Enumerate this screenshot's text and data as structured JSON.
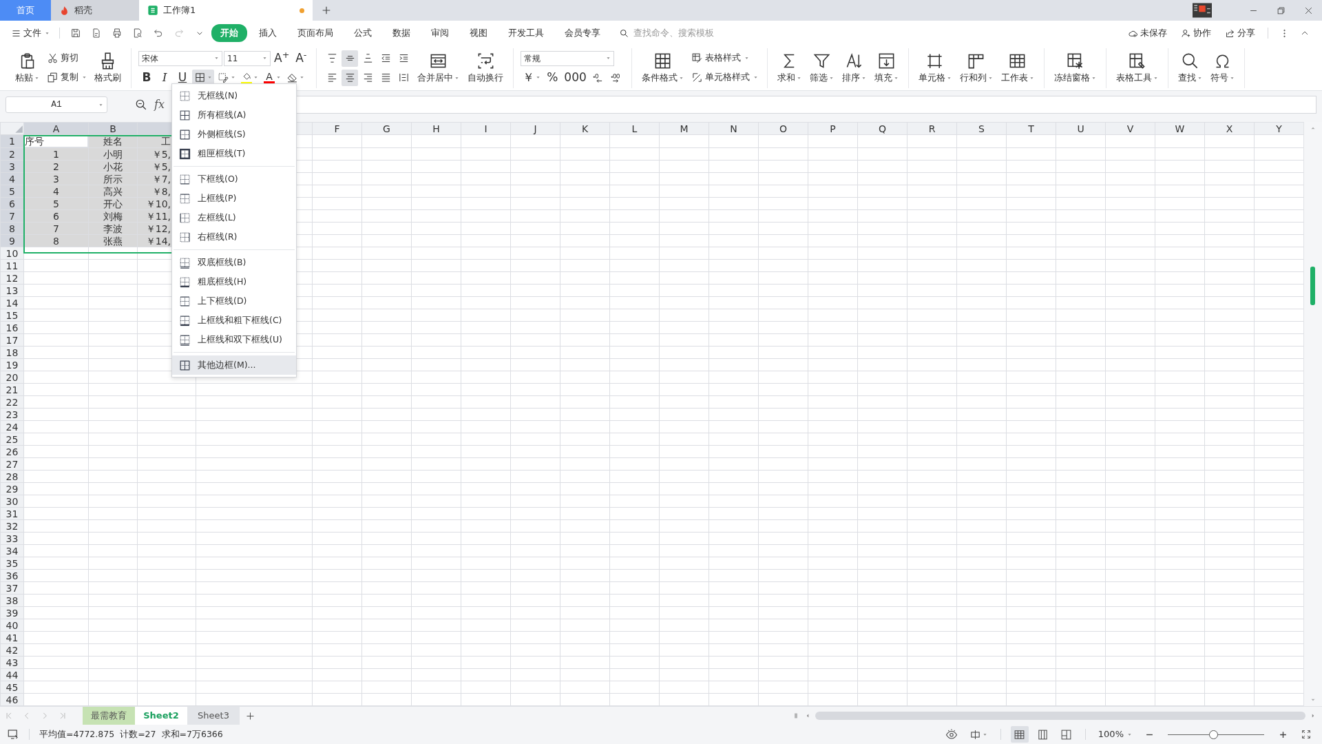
{
  "title_tabs": [
    {
      "label": "首页",
      "kind": "home",
      "selected": false
    },
    {
      "label": "稻壳",
      "kind": "docer",
      "selected": false
    },
    {
      "label": "工作簿1",
      "kind": "sheet",
      "selected": true,
      "modified": true
    }
  ],
  "menu": {
    "file": "文件",
    "tabs": [
      {
        "label": "开始",
        "selected": true
      },
      {
        "label": "插入",
        "selected": false
      },
      {
        "label": "页面布局",
        "selected": false
      },
      {
        "label": "公式",
        "selected": false
      },
      {
        "label": "数据",
        "selected": false
      },
      {
        "label": "审阅",
        "selected": false
      },
      {
        "label": "视图",
        "selected": false
      },
      {
        "label": "开发工具",
        "selected": false
      },
      {
        "label": "会员专享",
        "selected": false
      }
    ],
    "search": {
      "placeholder": "查找命令、搜索模板"
    },
    "actions": [
      "未保存",
      "协作",
      "分享"
    ]
  },
  "ribbon": [
    {
      "items": [
        {
          "kind": "large",
          "label": "粘贴",
          "caret": true
        },
        {
          "kind": "stack",
          "rows": [
            [
              {
                "kind": "small",
                "label": "剪切",
                "caret": false
              }
            ],
            [
              {
                "kind": "small",
                "label": "复制",
                "caret": true
              }
            ]
          ]
        },
        {
          "kind": "large",
          "label": "格式刷",
          "caret": false
        }
      ]
    },
    {
      "items": [
        {
          "kind": "stack",
          "rows": [
            [
              {
                "kind": "font-select",
                "value": "宋体"
              },
              {
                "kind": "size-select",
                "value": "11"
              },
              {
                "kind": "glyph",
                "label": "A$^{+}$",
                "active": false,
                "caret": false
              },
              {
                "kind": "glyph",
                "label": "A$^{-}$",
                "active": false,
                "caret": false
              }
            ],
            [
              {
                "kind": "bold-glyph",
                "label": "B",
                "active": false,
                "caret": false
              },
              {
                "kind": "italic-glyph",
                "label": "I",
                "active": false,
                "caret": false
              },
              {
                "kind": "underline-glyph",
                "label": "U",
                "active": false,
                "caret": false
              },
              {
                "kind": "icon",
                "active": true,
                "caret": true
              },
              {
                "kind": "icon",
                "active": false,
                "caret": true
              },
              {
                "kind": "icon",
                "active": false,
                "caret": true,
                "color": "#ffff00"
              },
              {
                "kind": "glyph",
                "label": "A",
                "active": false,
                "caret": true,
                "color": "#ff0000"
              },
              {
                "kind": "icon",
                "active": false,
                "caret": true
              }
            ]
          ]
        }
      ]
    },
    {
      "items": [
        {
          "kind": "stack",
          "rows": [
            [
              {
                "kind": "icon",
                "active": false,
                "caret": false
              },
              {
                "kind": "icon",
                "active": true,
                "caret": false
              },
              {
                "kind": "icon",
                "active": false,
                "caret": false
              },
              {
                "kind": "icon",
                "active": false,
                "caret": false
              },
              {
                "kind": "icon",
                "active": false,
                "caret": false
              }
            ],
            [
              {
                "kind": "icon",
                "active": false,
                "caret": false
              },
              {
                "kind": "icon",
                "active": true,
                "caret": false
              },
              {
                "kind": "icon",
                "active": false,
                "caret": false
              },
              {
                "kind": "icon",
                "active": false,
                "caret": false
              },
              {
                "kind": "icon",
                "active": false,
                "caret": false
              }
            ]
          ]
        },
        {
          "kind": "large",
          "label": "合并居中",
          "caret": true
        },
        {
          "kind": "large",
          "label": "自动换行",
          "caret": false
        }
      ]
    },
    {
      "items": [
        {
          "kind": "stack",
          "rows": [
            [
              {
                "kind": "format-select",
                "value": "常规"
              }
            ],
            [
              {
                "kind": "glyph",
                "label": "￥",
                "active": false,
                "caret": true
              },
              {
                "kind": "glyph",
                "label": "%",
                "active": false,
                "caret": false
              },
              {
                "kind": "glyph",
                "label": "000",
                "active": false,
                "caret": false
              },
              {
                "kind": "icon",
                "active": false,
                "caret": false
              },
              {
                "kind": "icon",
                "active": false,
                "caret": false
              }
            ]
          ]
        }
      ]
    },
    {
      "items": [
        {
          "kind": "large",
          "label": "条件格式",
          "caret": true
        },
        {
          "kind": "stack",
          "rows": [
            [
              {
                "kind": "small",
                "label": "表格样式",
                "caret": true
              }
            ],
            [
              {
                "kind": "small",
                "label": "单元格样式",
                "caret": true
              }
            ]
          ]
        }
      ]
    },
    {
      "items": [
        {
          "kind": "large",
          "label": "求和",
          "caret": true
        },
        {
          "kind": "large",
          "label": "筛选",
          "caret": true
        },
        {
          "kind": "large",
          "label": "排序",
          "caret": true
        },
        {
          "kind": "large",
          "label": "填充",
          "caret": true
        }
      ]
    },
    {
      "items": [
        {
          "kind": "large",
          "label": "单元格",
          "caret": true
        },
        {
          "kind": "large",
          "label": "行和列",
          "caret": true
        },
        {
          "kind": "large",
          "label": "工作表",
          "caret": true
        }
      ]
    },
    {
      "items": [
        {
          "kind": "large",
          "label": "冻结窗格",
          "caret": true
        }
      ]
    },
    {
      "items": [
        {
          "kind": "large",
          "label": "表格工具",
          "caret": true
        }
      ]
    },
    {
      "items": [
        {
          "kind": "large",
          "label": "查找",
          "caret": true
        },
        {
          "kind": "large",
          "label": "符号",
          "caret": true
        }
      ]
    }
  ],
  "formula_bar": {
    "cell_ref": "A1",
    "fx": "fx"
  },
  "sheet": {
    "columns": [
      {
        "label": "A",
        "selected": true
      },
      {
        "label": "B",
        "selected": true
      }
    ],
    "covered_columns": [
      {
        "selected": true
      }
    ],
    "more_columns": [
      {
        "label": "F",
        "selected": false
      },
      {
        "label": "G",
        "selected": false
      },
      {
        "label": "H",
        "selected": false
      },
      {
        "label": "I",
        "selected": false
      },
      {
        "label": "J",
        "selected": false
      },
      {
        "label": "K",
        "selected": false
      },
      {
        "label": "L",
        "selected": false
      },
      {
        "label": "M",
        "selected": false
      },
      {
        "label": "N",
        "selected": false
      },
      {
        "label": "O",
        "selected": false
      },
      {
        "label": "P",
        "selected": false
      },
      {
        "label": "Q",
        "selected": false
      },
      {
        "label": "R",
        "selected": false
      },
      {
        "label": "S",
        "selected": false
      },
      {
        "label": "T",
        "selected": false
      },
      {
        "label": "U",
        "selected": false
      },
      {
        "label": "V",
        "selected": false
      },
      {
        "label": "W",
        "selected": false
      },
      {
        "label": "X",
        "selected": false
      },
      {
        "label": "Y",
        "selected": false
      }
    ],
    "rows": [
      {
        "label": "1",
        "selected": true,
        "cells": [
          {
            "text": "序号",
            "active": true
          },
          {
            "text": "姓名",
            "active": false
          },
          {
            "text": "工",
            "active": false
          }
        ]
      },
      {
        "label": "2",
        "selected": true,
        "cells": [
          {
            "text": "1",
            "active": false
          },
          {
            "text": "小明",
            "active": false
          },
          {
            "text": "￥5,",
            "active": false
          }
        ]
      },
      {
        "label": "3",
        "selected": true,
        "cells": [
          {
            "text": "2",
            "active": false
          },
          {
            "text": "小花",
            "active": false
          },
          {
            "text": "￥5,",
            "active": false
          }
        ]
      },
      {
        "label": "4",
        "selected": true,
        "cells": [
          {
            "text": "3",
            "active": false
          },
          {
            "text": "所示",
            "active": false
          },
          {
            "text": "￥7,",
            "active": false
          }
        ]
      },
      {
        "label": "5",
        "selected": true,
        "cells": [
          {
            "text": "4",
            "active": false
          },
          {
            "text": "高兴",
            "active": false
          },
          {
            "text": "￥8,",
            "active": false
          }
        ]
      },
      {
        "label": "6",
        "selected": true,
        "cells": [
          {
            "text": "5",
            "active": false
          },
          {
            "text": "开心",
            "active": false
          },
          {
            "text": "￥10,",
            "active": false
          }
        ]
      },
      {
        "label": "7",
        "selected": true,
        "cells": [
          {
            "text": "6",
            "active": false
          },
          {
            "text": "刘梅",
            "active": false
          },
          {
            "text": "￥11,",
            "active": false
          }
        ]
      },
      {
        "label": "8",
        "selected": true,
        "cells": [
          {
            "text": "7",
            "active": false
          },
          {
            "text": "李波",
            "active": false
          },
          {
            "text": "￥12,",
            "active": false
          }
        ]
      },
      {
        "label": "9",
        "selected": true,
        "cells": [
          {
            "text": "8",
            "active": false
          },
          {
            "text": "张燕",
            "active": false
          },
          {
            "text": "￥14,",
            "active": false
          }
        ]
      },
      {
        "label": "10",
        "selected": false
      },
      {
        "label": "11",
        "selected": false
      },
      {
        "label": "12",
        "selected": false
      },
      {
        "label": "13",
        "selected": false
      },
      {
        "label": "14",
        "selected": false
      },
      {
        "label": "15",
        "selected": false
      },
      {
        "label": "16",
        "selected": false
      },
      {
        "label": "17",
        "selected": false
      },
      {
        "label": "18",
        "selected": false
      },
      {
        "label": "19",
        "selected": false
      },
      {
        "label": "20",
        "selected": false
      },
      {
        "label": "21",
        "selected": false
      },
      {
        "label": "22",
        "selected": false
      },
      {
        "label": "23",
        "selected": false
      },
      {
        "label": "24",
        "selected": false
      },
      {
        "label": "25",
        "selected": false
      },
      {
        "label": "26",
        "selected": false
      },
      {
        "label": "27",
        "selected": false
      },
      {
        "label": "28",
        "selected": false
      },
      {
        "label": "29",
        "selected": false
      },
      {
        "label": "30",
        "selected": false
      },
      {
        "label": "31",
        "selected": false
      },
      {
        "label": "32",
        "selected": false
      },
      {
        "label": "33",
        "selected": false
      },
      {
        "label": "34",
        "selected": false
      },
      {
        "label": "35",
        "selected": false
      },
      {
        "label": "36",
        "selected": false
      },
      {
        "label": "37",
        "selected": false
      },
      {
        "label": "38",
        "selected": false
      },
      {
        "label": "39",
        "selected": false
      },
      {
        "label": "40",
        "selected": false
      },
      {
        "label": "41",
        "selected": false
      },
      {
        "label": "42",
        "selected": false
      },
      {
        "label": "43",
        "selected": false
      },
      {
        "label": "44",
        "selected": false
      },
      {
        "label": "45",
        "selected": false
      },
      {
        "label": "46",
        "selected": false
      }
    ]
  },
  "border_menu": {
    "groups": [
      [
        {
          "label": "无框线(N)",
          "kind": "none",
          "selected": false
        },
        {
          "label": "所有框线(A)",
          "kind": "all",
          "selected": false
        },
        {
          "label": "外侧框线(S)",
          "kind": "outside",
          "selected": false
        },
        {
          "label": "粗匣框线(T)",
          "kind": "thick-box",
          "selected": false
        }
      ],
      [
        {
          "label": "下框线(O)",
          "kind": "bottom",
          "selected": false
        },
        {
          "label": "上框线(P)",
          "kind": "top",
          "selected": false
        },
        {
          "label": "左框线(L)",
          "kind": "left",
          "selected": false
        },
        {
          "label": "右框线(R)",
          "kind": "right",
          "selected": false
        }
      ],
      [
        {
          "label": "双底框线(B)",
          "kind": "double-bottom",
          "selected": false
        },
        {
          "label": "粗底框线(H)",
          "kind": "thick-bottom",
          "selected": false
        },
        {
          "label": "上下框线(D)",
          "kind": "top-bottom",
          "selected": false
        },
        {
          "label": "上框线和粗下框线(C)",
          "kind": "top-thick-bottom",
          "selected": false
        },
        {
          "label": "上框线和双下框线(U)",
          "kind": "top-double-bottom",
          "selected": false
        }
      ],
      [
        {
          "label": "其他边框(M)...",
          "kind": "more",
          "selected": true
        }
      ]
    ]
  },
  "sheet_tabs": [
    {
      "label": "最需教育",
      "selected": false,
      "color": "#c6e2b3"
    },
    {
      "label": "Sheet2",
      "selected": true
    },
    {
      "label": "Sheet3",
      "selected": false
    }
  ],
  "status_bar": {
    "stats": [
      "平均值=4772.875",
      "计数=27",
      "求和=7万6366"
    ],
    "views": [
      {
        "selected": true
      },
      {
        "selected": false
      },
      {
        "selected": false
      }
    ],
    "zoom": "100%",
    "zoom_slider": {
      "level": 0.47
    }
  }
}
